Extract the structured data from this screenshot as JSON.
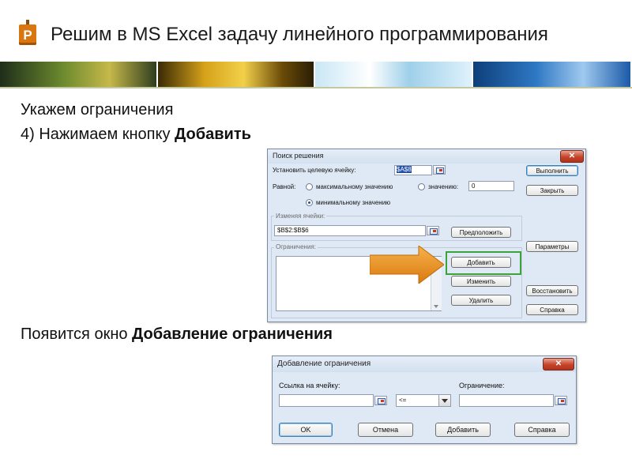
{
  "slide": {
    "logo_letter": "P",
    "title": "Решим в MS Excel задачу линейного программирования",
    "line1": "Укажем ограничения",
    "line2_prefix": "4) Нажимаем кнопку ",
    "line2_bold": "Добавить",
    "line3_prefix": "Появится окно ",
    "line3_bold": "Добавление ограничения"
  },
  "solver_dialog": {
    "title": "Поиск решения",
    "close": "✕",
    "target_label": "Установить целевую ячейку:",
    "target_value": "$A$8",
    "equal_label": "Равной:",
    "opt_max": "максимальному значению",
    "opt_value": "значению:",
    "value_field": "0",
    "opt_min": "минимальному значению",
    "changing_label": "Изменяя ячейки:",
    "changing_value": "$B$2:$B$6",
    "constraints_label": "Ограничения:",
    "buttons": {
      "solve": "Выполнить",
      "close": "Закрыть",
      "guess": "Предположить",
      "options": "Параметры",
      "add": "Добавить",
      "change": "Изменить",
      "reset": "Восстановить",
      "delete": "Удалить",
      "help": "Справка"
    },
    "selected_option": "min"
  },
  "constraint_dialog": {
    "title": "Добавление ограничения",
    "close": "✕",
    "cell_ref_label": "Ссылка на ячейку:",
    "cell_ref_value": "",
    "operator": "<=",
    "constraint_label": "Ограничение:",
    "constraint_value": "",
    "buttons": {
      "ok": "OK",
      "cancel": "Отмена",
      "add": "Добавить",
      "help": "Справка"
    }
  },
  "icons": [
    "logo-flag-icon",
    "close-icon",
    "cell-reference-icon",
    "dropdown-arrow-icon",
    "orange-arrow-icon"
  ],
  "colors": {
    "accent_orange": "#e8911e",
    "highlight_green": "#3aa33a",
    "dialog_bg": "#dfe9f5",
    "close_red": "#c7432a"
  }
}
